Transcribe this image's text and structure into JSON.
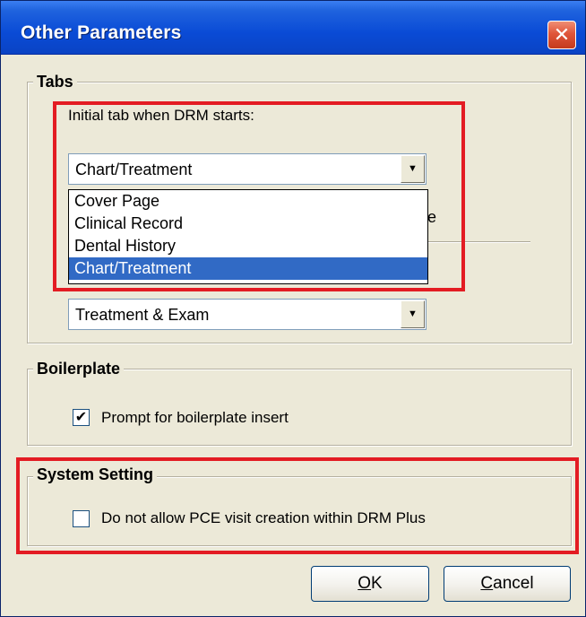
{
  "dialog": {
    "title": "Other Parameters",
    "close_symbol": "✕"
  },
  "tabs_group": {
    "label": "Tabs",
    "initial_tab_label": "Initial tab when DRM starts:",
    "initial_tab_value": "Chart/Treatment",
    "dropdown_options": [
      "Cover Page",
      "Clinical Record",
      "Dental History",
      "Chart/Treatment"
    ],
    "dropdown_selected_index": 3,
    "hidden_label_fragment": "e",
    "second_value": "Treatment & Exam",
    "arrow_glyph": "▼"
  },
  "boilerplate_group": {
    "label": "Boilerplate",
    "prompt_checkbox_label": "Prompt for boilerplate insert",
    "prompt_checked": true,
    "check_glyph": "✔"
  },
  "system_group": {
    "label": "System Setting",
    "pce_checkbox_label": "Do not allow PCE visit creation within DRM Plus",
    "pce_checked": false
  },
  "buttons": {
    "ok_label": "OK",
    "ok_accel": "O",
    "ok_rest": "K",
    "cancel_label": "Cancel",
    "cancel_accel": "C",
    "cancel_rest": "ancel"
  },
  "colors": {
    "highlight_red": "#e31c23",
    "selection_blue": "#316ac5",
    "titlebar_blue": "#0a4bd6",
    "dialog_bg": "#ece9d8"
  }
}
